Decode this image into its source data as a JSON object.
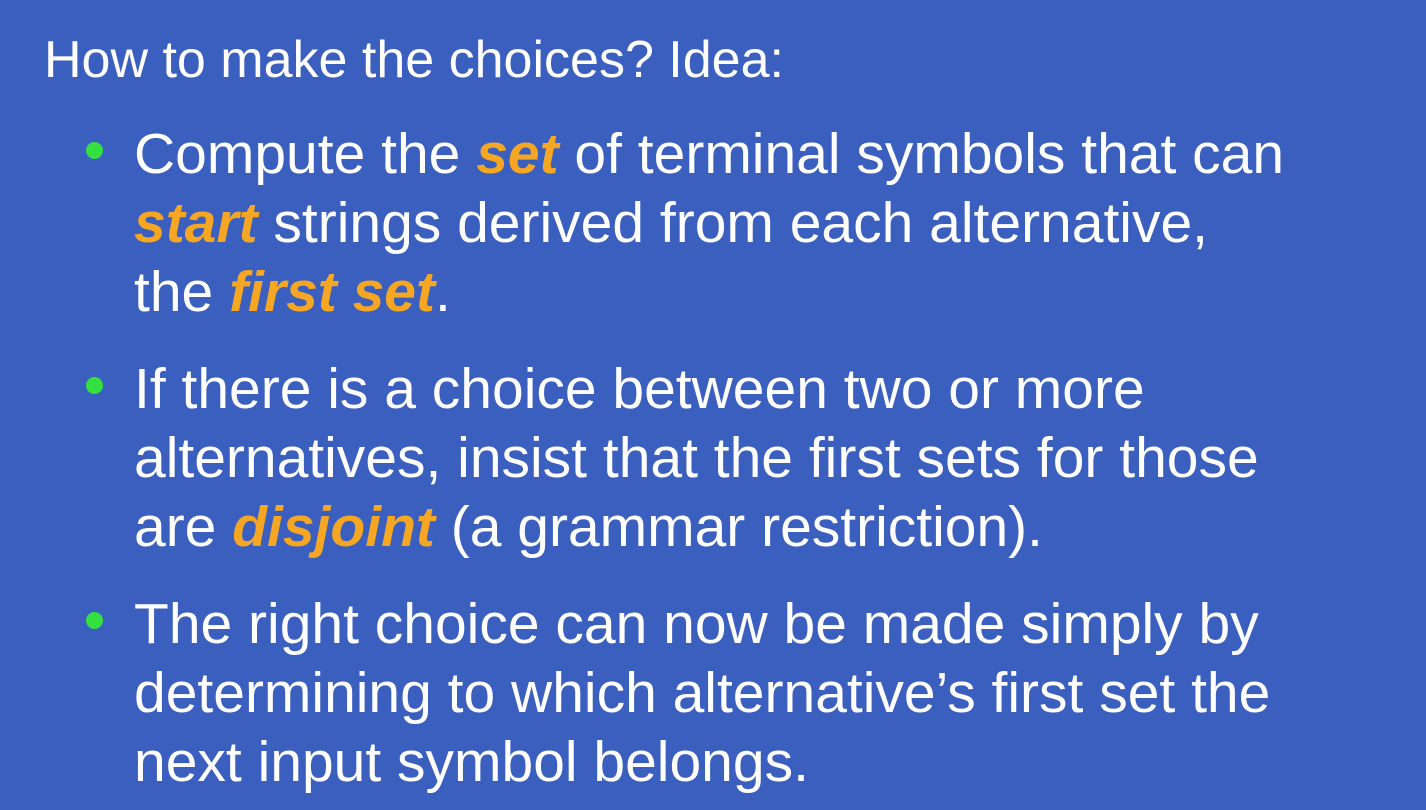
{
  "slide": {
    "intro": "How to make the choices? Idea:",
    "bullets": [
      {
        "lines": [
          [
            {
              "text": "Compute the ",
              "emphasis": false
            },
            {
              "text": "set",
              "emphasis": true
            },
            {
              "text": " of terminal symbols that can",
              "emphasis": false
            }
          ],
          [
            {
              "text": "start",
              "emphasis": true
            },
            {
              "text": " strings derived from each alternative,",
              "emphasis": false
            }
          ],
          [
            {
              "text": "the ",
              "emphasis": false
            },
            {
              "text": "first set",
              "emphasis": true
            },
            {
              "text": ".",
              "emphasis": false
            }
          ]
        ]
      },
      {
        "lines": [
          [
            {
              "text": "If there is a choice between two or more",
              "emphasis": false
            }
          ],
          [
            {
              "text": "alternatives, insist that the first sets for those",
              "emphasis": false
            }
          ],
          [
            {
              "text": "are ",
              "emphasis": false
            },
            {
              "text": "disjoint",
              "emphasis": true
            },
            {
              "text": " (a grammar restriction).",
              "emphasis": false
            }
          ]
        ]
      },
      {
        "lines": [
          [
            {
              "text": "The right choice can now be made simply by",
              "emphasis": false
            }
          ],
          [
            {
              "text": "determining to which alternative’s first set the",
              "emphasis": false
            }
          ],
          [
            {
              "text": "next input symbol belongs.",
              "emphasis": false
            }
          ]
        ]
      }
    ]
  },
  "colors": {
    "background": "#3a5fbf",
    "text": "#ffffff",
    "emphasis": "#f5a623",
    "bullet": "#33e040"
  }
}
